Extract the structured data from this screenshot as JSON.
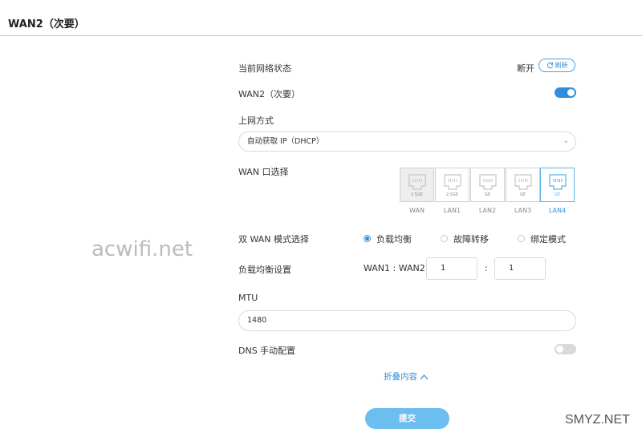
{
  "page": {
    "title": "WAN2（次要）"
  },
  "status": {
    "label": "当前网络状态",
    "value": "断开",
    "refresh_label": "刷新"
  },
  "wan2": {
    "label": "WAN2（次要）",
    "enabled": true
  },
  "access": {
    "label": "上网方式",
    "value": "自动获取 IP（DHCP）"
  },
  "port_select": {
    "label": "WAN 口选择",
    "ports": [
      {
        "name": "WAN",
        "speed": "2.5GE",
        "state": "disabled"
      },
      {
        "name": "LAN1",
        "speed": "2.5GE",
        "state": "normal"
      },
      {
        "name": "LAN2",
        "speed": "GE",
        "state": "normal"
      },
      {
        "name": "LAN3",
        "speed": "GE",
        "state": "normal"
      },
      {
        "name": "LAN4",
        "speed": "GE",
        "state": "selected"
      }
    ]
  },
  "dual_wan": {
    "label": "双 WAN 模式选择",
    "options": [
      {
        "label": "负载均衡",
        "checked": true
      },
      {
        "label": "故障转移",
        "checked": false
      },
      {
        "label": "绑定模式",
        "checked": false
      }
    ]
  },
  "load_balance": {
    "label": "负载均衡设置",
    "ratio_label": "WAN1 : WAN2",
    "wan1": "1",
    "separator": ":",
    "wan2": "1"
  },
  "mtu": {
    "label": "MTU",
    "value": "1480"
  },
  "dns": {
    "label": "DNS 手动配置",
    "enabled": false
  },
  "collapse_label": "折叠内容",
  "submit_label": "提交",
  "watermarks": {
    "left": "acwifi.net",
    "bottom_right": "SMYZ.NET"
  },
  "colors": {
    "accent": "#2e8ede",
    "submit_bg": "#6cbdf0",
    "divider": "#c8c8c8"
  }
}
